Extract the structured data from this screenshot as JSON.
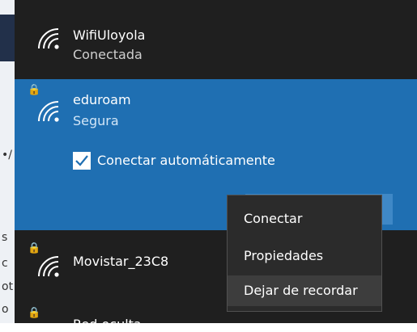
{
  "background": {
    "fragments": [
      "s",
      "c",
      "ot",
      "o",
      "•/"
    ]
  },
  "networks": [
    {
      "name": "WifiUloyola",
      "status": "Conectada",
      "secured": false
    },
    {
      "name": "eduroam",
      "status": "Segura",
      "secured": true,
      "selected": true,
      "auto_connect_label": "Conectar automáticamente",
      "auto_connect_checked": true
    },
    {
      "name": "Movistar_23C8",
      "secured": true
    },
    {
      "name": "Red oculta",
      "secured": true
    }
  ],
  "context_menu": {
    "items": [
      "Conectar",
      "Propiedades",
      "Dejar de recordar"
    ],
    "highlighted": "Dejar de recordar"
  },
  "colors": {
    "panel_bg": "#1f1f1f",
    "selected_bg": "#1f6fb2",
    "accent_button": "#3f88c6",
    "menu_bg": "#2b2b2b"
  },
  "icons": {
    "wifi": "wifi-signal-icon",
    "lock": "lock-icon",
    "checkbox": "checkbox-checked-icon"
  }
}
